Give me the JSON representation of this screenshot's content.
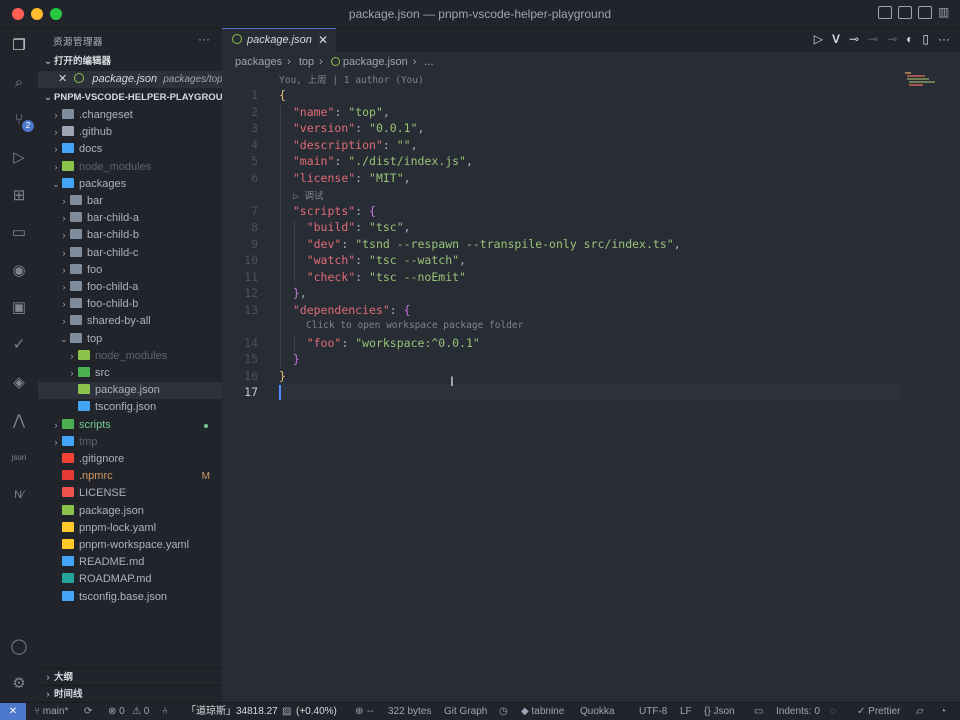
{
  "window": {
    "title": "package.json — pnpm-vscode-helper-playground"
  },
  "colors": {
    "accent": "#4d78cc",
    "editor_bg": "#282c34",
    "sidebar_bg": "#21252b",
    "close": "#ff5f57",
    "minimize": "#febc2e",
    "maximize": "#28c840"
  },
  "activity_bar": {
    "scm_badge": "2",
    "icons": [
      "explorer-icon",
      "search-icon",
      "source-control-icon",
      "run-debug-icon",
      "extensions-icon",
      "remote-explorer-icon",
      "github-icon",
      "folder-icon",
      "checklist-icon",
      "quokka-icon",
      "graph-icon",
      "json-icon",
      "nx-icon",
      "account-icon",
      "settings-gear-icon"
    ]
  },
  "sidebar": {
    "title": "资源管理器",
    "more": "···",
    "open_editors_header": "打开的编辑器",
    "open_editor": {
      "name": "package.json",
      "path": "packages/top"
    },
    "workspace_header": "PNPM-VSCODE-HELPER-PLAYGROU...",
    "tree": [
      {
        "label": ".changeset",
        "arrow": "›",
        "icon_color": "#7f8c9b"
      },
      {
        "label": ".github",
        "arrow": "›",
        "icon_color": "#9da5b4"
      },
      {
        "label": "docs",
        "arrow": "›",
        "icon_color": "#42a5f5"
      },
      {
        "label": "node_modules",
        "arrow": "›",
        "icon_color": "#8bc34a"
      },
      {
        "label": "packages",
        "arrow": "⌄",
        "icon_color": "#42a5f5"
      },
      {
        "label": "bar",
        "arrow": "›",
        "icon_color": "#7f8c9b"
      },
      {
        "label": "bar-child-a",
        "arrow": "›",
        "icon_color": "#7f8c9b"
      },
      {
        "label": "bar-child-b",
        "arrow": "›",
        "icon_color": "#7f8c9b"
      },
      {
        "label": "bar-child-c",
        "arrow": "›",
        "icon_color": "#7f8c9b"
      },
      {
        "label": "foo",
        "arrow": "›",
        "icon_color": "#7f8c9b"
      },
      {
        "label": "foo-child-a",
        "arrow": "›",
        "icon_color": "#7f8c9b"
      },
      {
        "label": "foo-child-b",
        "arrow": "›",
        "icon_color": "#7f8c9b"
      },
      {
        "label": "shared-by-all",
        "arrow": "›",
        "icon_color": "#7f8c9b"
      },
      {
        "label": "top",
        "arrow": "⌄",
        "icon_color": "#7f8c9b"
      },
      {
        "label": "node_modules",
        "arrow": "›",
        "icon_color": "#8bc34a"
      },
      {
        "label": "src",
        "arrow": "›",
        "icon_color": "#4caf50"
      },
      {
        "label": "package.json",
        "arrow": "",
        "icon_color": "#8bc34a"
      },
      {
        "label": "tsconfig.json",
        "arrow": "",
        "icon_color": "#42a5f5"
      },
      {
        "label": "scripts",
        "arrow": "›",
        "icon_color": "#4caf50"
      },
      {
        "label": "tmp",
        "arrow": "›",
        "icon_color": "#42a5f5"
      },
      {
        "label": ".gitignore",
        "arrow": "",
        "icon_color": "#f44336"
      },
      {
        "label": ".npmrc",
        "arrow": "",
        "icon_color": "#e53935",
        "flag": "M"
      },
      {
        "label": "LICENSE",
        "arrow": "",
        "icon_color": "#ef5350"
      },
      {
        "label": "package.json",
        "arrow": "",
        "icon_color": "#8bc34a"
      },
      {
        "label": "pnpm-lock.yaml",
        "arrow": "",
        "icon_color": "#ffca28"
      },
      {
        "label": "pnpm-workspace.yaml",
        "arrow": "",
        "icon_color": "#ffca28"
      },
      {
        "label": "README.md",
        "arrow": "",
        "icon_color": "#42a5f5"
      },
      {
        "label": "ROADMAP.md",
        "arrow": "",
        "icon_color": "#26a69a"
      },
      {
        "label": "tsconfig.base.json",
        "arrow": "",
        "icon_color": "#42a5f5"
      }
    ],
    "outline_header": "大纲",
    "timeline_header": "时间线"
  },
  "editor": {
    "tab_label": "package.json",
    "tab_close": "✕",
    "breadcrumb": [
      "packages",
      "›",
      "top",
      "›",
      "package.json",
      "›",
      "..."
    ],
    "blame": "You, 上周 | 1 author (You)",
    "inlay_debug": "▷ 调试",
    "inlay_workspace": "Click to open workspace package folder",
    "current_line": 17,
    "lines": [
      {
        "n": 1,
        "parts": [
          [
            "b",
            "{"
          ]
        ]
      },
      {
        "n": 2,
        "parts": [
          [
            "",
            "  "
          ],
          [
            "k",
            "\"name\""
          ],
          [
            "",
            ": "
          ],
          [
            "s",
            "\"top\""
          ],
          [
            "",
            ","
          ]
        ]
      },
      {
        "n": 3,
        "parts": [
          [
            "",
            "  "
          ],
          [
            "k",
            "\"version\""
          ],
          [
            "",
            ": "
          ],
          [
            "s",
            "\"0.0.1\""
          ],
          [
            "",
            ","
          ]
        ]
      },
      {
        "n": 4,
        "parts": [
          [
            "",
            "  "
          ],
          [
            "k",
            "\"description\""
          ],
          [
            "",
            ": "
          ],
          [
            "s",
            "\"\""
          ],
          [
            "",
            ","
          ]
        ]
      },
      {
        "n": 5,
        "parts": [
          [
            "",
            "  "
          ],
          [
            "k",
            "\"main\""
          ],
          [
            "",
            ": "
          ],
          [
            "s",
            "\"./dist/index.js\""
          ],
          [
            "",
            ","
          ]
        ]
      },
      {
        "n": 6,
        "parts": [
          [
            "",
            "  "
          ],
          [
            "k",
            "\"license\""
          ],
          [
            "",
            ": "
          ],
          [
            "s",
            "\"MIT\""
          ],
          [
            "",
            ","
          ]
        ]
      },
      {
        "n": 7,
        "parts": [
          [
            "",
            "  "
          ],
          [
            "k",
            "\"scripts\""
          ],
          [
            "",
            ": "
          ],
          [
            "p",
            "{"
          ]
        ]
      },
      {
        "n": 8,
        "parts": [
          [
            "",
            "    "
          ],
          [
            "k",
            "\"build\""
          ],
          [
            "",
            ": "
          ],
          [
            "s",
            "\"tsc\""
          ],
          [
            "",
            ","
          ]
        ]
      },
      {
        "n": 9,
        "parts": [
          [
            "",
            "    "
          ],
          [
            "k",
            "\"dev\""
          ],
          [
            "",
            ": "
          ],
          [
            "s",
            "\"tsnd --respawn --transpile-only src/index.ts\""
          ],
          [
            "",
            ","
          ]
        ]
      },
      {
        "n": 10,
        "parts": [
          [
            "",
            "    "
          ],
          [
            "k",
            "\"watch\""
          ],
          [
            "",
            ": "
          ],
          [
            "s",
            "\"tsc --watch\""
          ],
          [
            "",
            ","
          ]
        ]
      },
      {
        "n": 11,
        "parts": [
          [
            "",
            "    "
          ],
          [
            "k",
            "\"check\""
          ],
          [
            "",
            ": "
          ],
          [
            "s",
            "\"tsc --noEmit\""
          ]
        ]
      },
      {
        "n": 12,
        "parts": [
          [
            "",
            "  "
          ],
          [
            "p",
            "}"
          ],
          [
            "",
            ","
          ]
        ]
      },
      {
        "n": 13,
        "parts": [
          [
            "",
            "  "
          ],
          [
            "k",
            "\"dependencies\""
          ],
          [
            "",
            ": "
          ],
          [
            "p",
            "{"
          ]
        ]
      },
      {
        "n": 14,
        "parts": [
          [
            "",
            "    "
          ],
          [
            "k",
            "\"foo\""
          ],
          [
            "",
            ": "
          ],
          [
            "s",
            "\"workspace:^0.0.1\""
          ]
        ]
      },
      {
        "n": 15,
        "parts": [
          [
            "",
            "  "
          ],
          [
            "p",
            "}"
          ]
        ]
      },
      {
        "n": 16,
        "parts": [
          [
            "b",
            "}"
          ]
        ]
      },
      {
        "n": 17,
        "parts": []
      }
    ]
  },
  "statusbar": {
    "remote": "✕",
    "branch": "main*",
    "errors": "⊗ 0",
    "warnings": "⚠ 0",
    "stock": "「道琼斯」34818.27",
    "stock_change": "(+0.40%)",
    "quokka_label": "--",
    "size": "322 bytes",
    "git_graph": "Git Graph",
    "tabnine": "tabnine",
    "quokka": "Quokka",
    "encoding": "UTF-8",
    "eol": "LF",
    "language": "Json",
    "indents": "Indents: 0",
    "prettier": "Prettier"
  }
}
